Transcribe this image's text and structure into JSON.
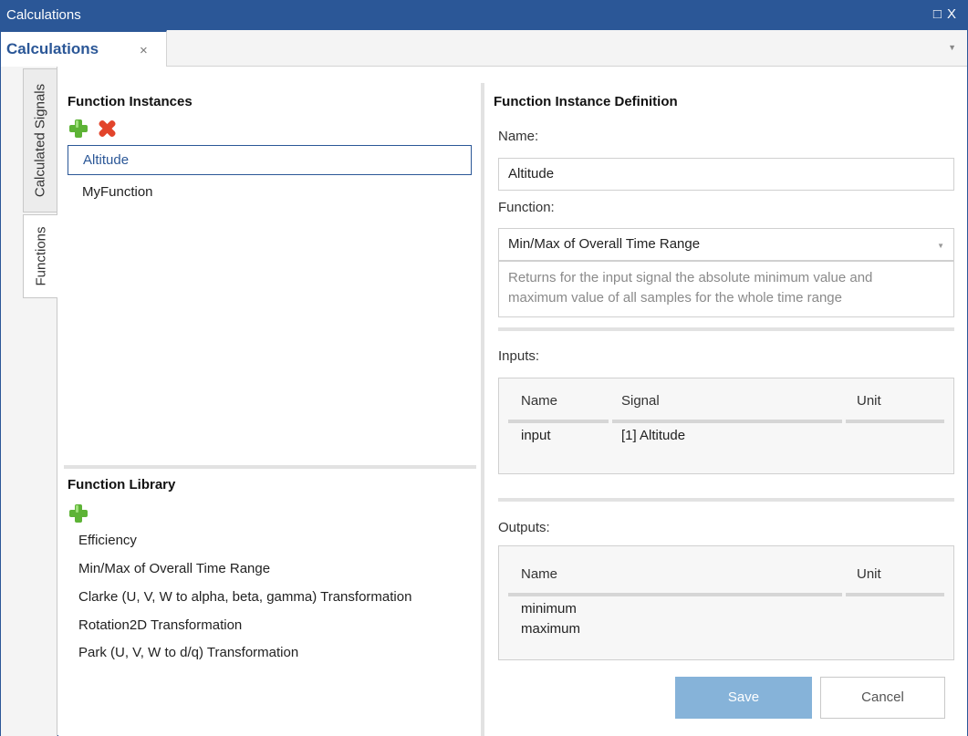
{
  "window": {
    "title": "Calculations",
    "controls": "□ X"
  },
  "tabs": {
    "document_tab_label": "Calculations",
    "close_glyph": "×",
    "menu_glyph": "▼"
  },
  "side_tabs": [
    {
      "label": "Calculated Signals",
      "active": false
    },
    {
      "label": "Functions",
      "active": true
    }
  ],
  "function_instances": {
    "title": "Function Instances",
    "add_icon": "plus-icon",
    "delete_icon": "delete-x-icon",
    "items": [
      {
        "label": "Altitude",
        "selected": true
      },
      {
        "label": "MyFunction",
        "selected": false
      }
    ]
  },
  "function_library": {
    "title": "Function Library",
    "add_icon": "plus-icon",
    "items": [
      "Efficiency",
      "Min/Max of Overall Time Range",
      "Clarke (U, V, W to alpha, beta, gamma) Transformation",
      "Rotation2D Transformation",
      "Park (U, V, W to d/q) Transformation"
    ]
  },
  "definition": {
    "title": "Function Instance Definition",
    "name_label": "Name:",
    "name_value": "Altitude",
    "function_label": "Function:",
    "function_value": "Min/Max of Overall Time Range",
    "description_line1": "Returns for the input signal the absolute minimum value and",
    "description_line2": "maximum value of all samples for the whole time range",
    "inputs_label": "Inputs:",
    "inputs": {
      "headers": {
        "name": "Name",
        "signal": "Signal",
        "unit": "Unit"
      },
      "rows": [
        {
          "name": "input",
          "signal": "[1] Altitude",
          "unit": ""
        }
      ]
    },
    "outputs_label": "Outputs:",
    "outputs": {
      "headers": {
        "name": "Name",
        "unit": "Unit"
      },
      "rows": [
        {
          "name": "minimum",
          "unit": ""
        },
        {
          "name": "maximum",
          "unit": ""
        }
      ]
    },
    "save_label": "Save",
    "cancel_label": "Cancel"
  },
  "colors": {
    "accent": "#2b5797",
    "add_green": "#5db336",
    "delete_red": "#e2442b",
    "save_disabled": "#86b3d9"
  }
}
